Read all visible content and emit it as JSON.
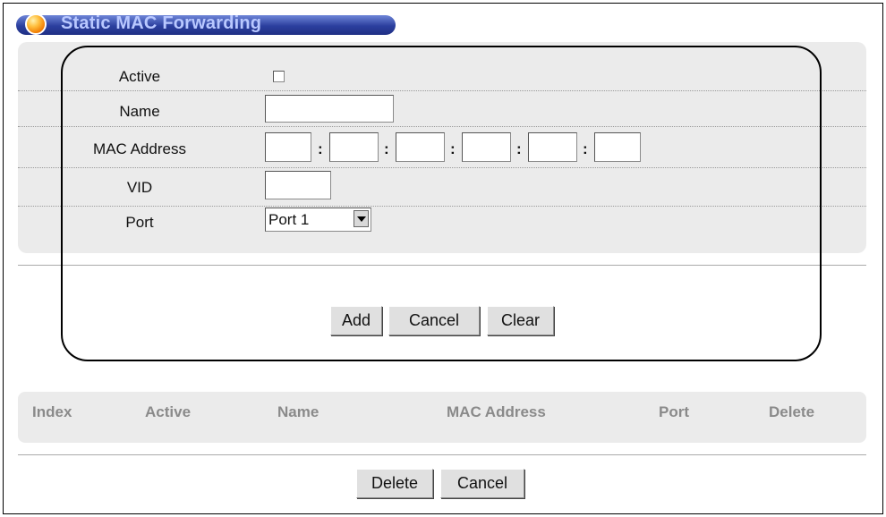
{
  "title": "Static MAC Forwarding",
  "form": {
    "active_label": "Active",
    "name_label": "Name",
    "mac_label": "MAC Address",
    "vid_label": "VID",
    "port_label": "Port",
    "port_value": "Port 1",
    "active_checked": false,
    "name_value": "",
    "vid_value": "",
    "mac_separator": ":"
  },
  "buttons": {
    "add": "Add",
    "cancel": "Cancel",
    "clear": "Clear"
  },
  "table": {
    "headers": [
      "Index",
      "Active",
      "Name",
      "MAC Address",
      "Port",
      "Delete"
    ]
  },
  "bottom_buttons": {
    "delete": "Delete",
    "cancel": "Cancel"
  },
  "colors": {
    "title_pill": "#2b3f9e",
    "title_text": "#b9c8ff",
    "panel_bg": "#ebebeb",
    "header_text": "#8a8a8a"
  }
}
